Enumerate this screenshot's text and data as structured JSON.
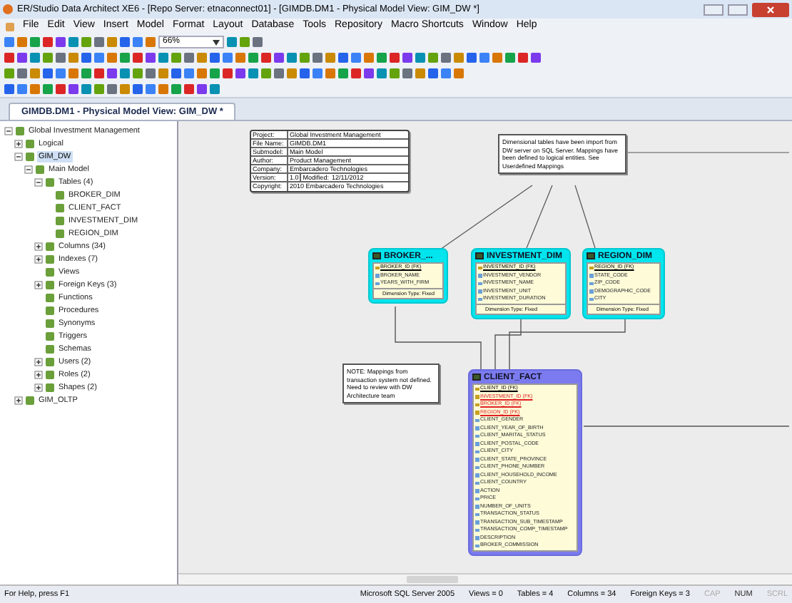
{
  "window": {
    "title": "ER/Studio Data Architect XE6 - [Repo Server: etnaconnect01] - [GIMDB.DM1 - Physical Model View: GIM_DW *]"
  },
  "menu": [
    "File",
    "Edit",
    "View",
    "Insert",
    "Model",
    "Format",
    "Layout",
    "Database",
    "Tools",
    "Repository",
    "Macro Shortcuts",
    "Window",
    "Help"
  ],
  "toolbar": {
    "zoom": "66%"
  },
  "tabs": [
    {
      "label": "GIMDB.DM1 - Physical Model View: GIM_DW *",
      "selected": true
    }
  ],
  "tree": [
    {
      "label": "Global Investment Management",
      "selected": false,
      "expanded": true,
      "children": [
        {
          "label": "Logical",
          "selected": false,
          "expanded": false
        },
        {
          "label": "GIM_DW",
          "selected": true,
          "expanded": true,
          "children": [
            {
              "label": "Main Model",
              "selected": false,
              "expanded": true,
              "children": [
                {
                  "label": "Tables (4)",
                  "selected": false,
                  "expanded": true,
                  "children": [
                    {
                      "label": "BROKER_DIM",
                      "selected": false
                    },
                    {
                      "label": "CLIENT_FACT",
                      "selected": false
                    },
                    {
                      "label": "INVESTMENT_DIM",
                      "selected": false
                    },
                    {
                      "label": "REGION_DIM",
                      "selected": false
                    }
                  ]
                },
                {
                  "label": "Columns (34)",
                  "selected": false,
                  "expanded": false
                },
                {
                  "label": "Indexes (7)",
                  "selected": false,
                  "expanded": false
                },
                {
                  "label": "Views",
                  "selected": false
                },
                {
                  "label": "Foreign Keys (3)",
                  "selected": false,
                  "expanded": false
                },
                {
                  "label": "Functions",
                  "selected": false
                },
                {
                  "label": "Procedures",
                  "selected": false
                },
                {
                  "label": "Synonyms",
                  "selected": false
                },
                {
                  "label": "Triggers",
                  "selected": false
                },
                {
                  "label": "Schemas",
                  "selected": false
                },
                {
                  "label": "Users (2)",
                  "selected": false,
                  "expanded": false
                },
                {
                  "label": "Roles (2)",
                  "selected": false,
                  "expanded": false
                },
                {
                  "label": "Shapes (2)",
                  "selected": false,
                  "expanded": false
                }
              ]
            }
          ]
        },
        {
          "label": "GIM_OLTP",
          "selected": false,
          "expanded": false
        }
      ]
    }
  ],
  "title_block": [
    {
      "label": "Project:",
      "value": "Global Investment Management"
    },
    {
      "label": "File Name:",
      "value": "GIMDB.DM1"
    },
    {
      "label": "Submodel:",
      "value": "Main Model"
    },
    {
      "label": "Author:",
      "value": "Product Management"
    },
    {
      "label": "Company:",
      "value": "Embarcadero Technologies"
    },
    {
      "label": "Version:",
      "value": "1.0",
      "label_2": "Modified:",
      "value_2": "12/11/2012"
    },
    {
      "label": "Copyright:",
      "value": "2010 Embarcadero Technologies"
    }
  ],
  "notes": [
    "Dimensional tables have been import from DW server on SQL Server. Mappings have been defined to logical entities. See Userdefined Mappings",
    "NOTE: Mappings from transaction system not defined. Need to review with DW Architecture team"
  ],
  "entities": [
    {
      "name": "BROKER_...",
      "kind": "dimension",
      "footer": "Dimension Type: Fixed",
      "columns": [
        {
          "name": "BROKER_ID (FK)",
          "kind": "pk"
        },
        {
          "name": "BROKER_NAME",
          "kind": "attribute"
        },
        {
          "name": "YEARS_WITH_FIRM",
          "kind": "attribute"
        }
      ]
    },
    {
      "name": "INVESTMENT_DIM",
      "kind": "dimension",
      "footer": "Dimension Type: Fixed",
      "columns": [
        {
          "name": "INVESTMENT_ID (FK)",
          "kind": "pk"
        },
        {
          "name": "INVESTMENT_VENDOR",
          "kind": "attribute"
        },
        {
          "name": "INVESTMENT_NAME",
          "kind": "attribute"
        },
        {
          "name": "INVESTMENT_UNIT",
          "kind": "attribute"
        },
        {
          "name": "INVESTMENT_DURATION",
          "kind": "attribute"
        }
      ]
    },
    {
      "name": "REGION_DIM",
      "kind": "dimension",
      "footer": "Dimension Type: Fixed",
      "columns": [
        {
          "name": "REGION_ID (FK)",
          "kind": "pk"
        },
        {
          "name": "STATE_CODE",
          "kind": "attribute"
        },
        {
          "name": "ZIP_CODE",
          "kind": "attribute"
        },
        {
          "name": "DEMOGRAPHIC_CODE",
          "kind": "attribute"
        },
        {
          "name": "CITY",
          "kind": "attribute"
        }
      ]
    },
    {
      "name": "CLIENT_FACT",
      "kind": "fact",
      "columns": [
        {
          "name": "CLIENT_ID (FK)",
          "kind": "pk"
        },
        {
          "name": "INVESTMENT_ID (FK)",
          "kind": "pk_fk"
        },
        {
          "name": "BROKER_ID (FK)",
          "kind": "pk_fk"
        },
        {
          "name": "REGION_ID (FK)",
          "kind": "pk_fk"
        },
        {
          "name": "CLIENT_GENDER",
          "kind": "attribute"
        },
        {
          "name": "CLIENT_YEAR_OF_BIRTH",
          "kind": "attribute"
        },
        {
          "name": "CLIENT_MARITAL_STATUS",
          "kind": "attribute"
        },
        {
          "name": "CLIENT_POSTAL_CODE",
          "kind": "attribute"
        },
        {
          "name": "CLIENT_CITY",
          "kind": "attribute"
        },
        {
          "name": "CLIENT_STATE_PROVINCE",
          "kind": "attribute"
        },
        {
          "name": "CLIENT_PHONE_NUMBER",
          "kind": "attribute"
        },
        {
          "name": "CLIENT_HOUSEHOLD_INCOME",
          "kind": "attribute"
        },
        {
          "name": "CLIENT_COUNTRY",
          "kind": "attribute"
        },
        {
          "name": "ACTION",
          "kind": "attribute"
        },
        {
          "name": "PRICE",
          "kind": "attribute"
        },
        {
          "name": "NUMBER_OF_UNITS",
          "kind": "attribute"
        },
        {
          "name": "TRANSACTION_STATUS",
          "kind": "attribute"
        },
        {
          "name": "TRANSACTION_SUB_TIMESTAMP",
          "kind": "attribute"
        },
        {
          "name": "TRANSACTION_COMP_TIMESTAMP",
          "kind": "attribute"
        },
        {
          "name": "DESCRIPTION",
          "kind": "attribute"
        },
        {
          "name": "BROKER_COMMISSION",
          "kind": "attribute"
        }
      ]
    }
  ],
  "status_bar": {
    "help": "For Help, press F1",
    "fields": [
      "Microsoft SQL Server 2005",
      "Views = 0",
      "Tables = 4",
      "Columns = 34",
      "Foreign Keys = 3"
    ],
    "indicators": [
      {
        "label": "CAP",
        "on": false
      },
      {
        "label": "NUM",
        "on": true
      },
      {
        "label": "SCRL",
        "on": false
      }
    ]
  }
}
